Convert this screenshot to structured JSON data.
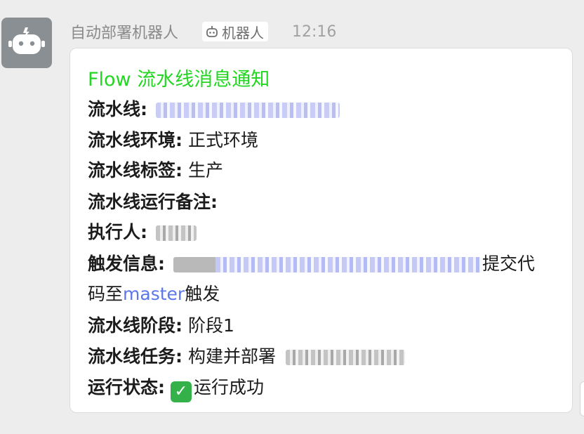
{
  "colors": {
    "background": "#ededed",
    "card": "#ffffff",
    "title": "#22d622",
    "link": "#5b77e8",
    "status_check": "#34b249"
  },
  "message": {
    "avatar_icon": "robot-icon",
    "sender": "自动部署机器人",
    "tag": {
      "icon": "robot-icon",
      "label": "机器人"
    },
    "time": "12:16"
  },
  "card": {
    "title": "Flow 流水线消息通知",
    "rows": [
      {
        "label": "流水线:",
        "value": ""
      },
      {
        "label": "流水线环境:",
        "value": " 正式环境"
      },
      {
        "label": "流水线标签:",
        "value": " 生产"
      },
      {
        "label": "流水线运行备注:",
        "value": ""
      },
      {
        "label": "执行人:",
        "value": ""
      },
      {
        "label": "触发信息:",
        "value_after": "提交代",
        "value_line2_prefix": "码至",
        "value_line2_link": "master",
        "value_line2_suffix": "触发"
      },
      {
        "label": "流水线阶段:",
        "value": " 阶段1"
      },
      {
        "label": "流水线任务:",
        "value": " 构建并部署"
      },
      {
        "label": "运行状态:",
        "status_icon": "check-mark-icon",
        "value": "运行成功"
      }
    ]
  }
}
